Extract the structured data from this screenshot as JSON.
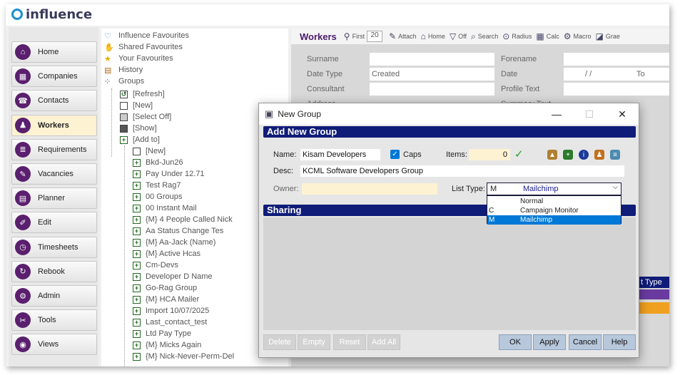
{
  "app": {
    "title": "influence"
  },
  "nav": {
    "items": [
      {
        "label": "Home",
        "icon": "home-icon",
        "glyph": "⌂"
      },
      {
        "label": "Companies",
        "icon": "companies-icon",
        "glyph": "▦"
      },
      {
        "label": "Contacts",
        "icon": "contacts-icon",
        "glyph": "☎"
      },
      {
        "label": "Workers",
        "icon": "workers-icon",
        "glyph": "♟"
      },
      {
        "label": "Requirements",
        "icon": "requirements-icon",
        "glyph": "≣"
      },
      {
        "label": "Vacancies",
        "icon": "vacancies-icon",
        "glyph": "✎"
      },
      {
        "label": "Planner",
        "icon": "planner-icon",
        "glyph": "▤"
      },
      {
        "label": "Edit",
        "icon": "edit-icon",
        "glyph": "✐"
      },
      {
        "label": "Timesheets",
        "icon": "timesheets-icon",
        "glyph": "◷"
      },
      {
        "label": "Rebook",
        "icon": "rebook-icon",
        "glyph": "↻"
      },
      {
        "label": "Admin",
        "icon": "admin-icon",
        "glyph": "⚙"
      },
      {
        "label": "Tools",
        "icon": "tools-icon",
        "glyph": "✂"
      },
      {
        "label": "Views",
        "icon": "views-icon",
        "glyph": "◉"
      }
    ],
    "active": "Workers"
  },
  "tree": {
    "top": [
      "Influence Favourites",
      "Shared Favourites",
      "Your Favourites",
      "History",
      "Groups"
    ],
    "groups": [
      "[Refresh]",
      "[New]",
      "[Select Off]",
      "[Show]",
      "[Add to]"
    ],
    "add_to": [
      "[New]",
      "Bkd-Jun26",
      "Pay Under 12.71",
      "Test Rag7",
      "00 Groups",
      "00 Instant Mail",
      "{M} 4 People Called Nick",
      "Aa Status Change Tes",
      "{M} Aa-Jack (Name)",
      "{M} Active Hcas",
      "Cm-Devs",
      "Developer D Name",
      "Go-Rag Group",
      "{M} HCA Mailer",
      "Import 10/07/2025",
      "Last_contact_test",
      "Ltd Pay Type",
      "{M} Micks Again",
      "{M} Nick-Never-Perm-Del"
    ]
  },
  "toolbar": {
    "title": "Workers",
    "first_label": "First",
    "first_value": "20",
    "attach": "Attach",
    "home": "Home",
    "off": "Off",
    "search": "Search",
    "radius": "Radius",
    "calc": "Calc",
    "macro": "Macro",
    "grae": "Grae"
  },
  "form": {
    "surname": "Surname",
    "forename": "Forename",
    "date_type": "Date Type",
    "date_type_value": "Created",
    "date": "Date",
    "date_value": "/ /",
    "to": "To",
    "consultant": "Consultant",
    "profile_text": "Profile Text",
    "address": "Address",
    "summary_text": "Summary Text"
  },
  "background_fragments": {
    "list_type_label": "t Type"
  },
  "dialog": {
    "title": "New Group",
    "header": "Add New Group",
    "name_label": "Name:",
    "name_value": "Kisam Developers",
    "caps_label": "Caps",
    "items_label": "Items:",
    "items_value": "0",
    "desc_label": "Desc:",
    "desc_value": "KCML Software Developers Group",
    "owner_label": "Owner:",
    "owner_value": "",
    "list_type_label": "List Type:",
    "list_type_code": "M",
    "list_type_value": "Mailchimp",
    "options": [
      {
        "code": "",
        "label": "Normal"
      },
      {
        "code": "C",
        "label": "Campaign Monitor"
      },
      {
        "code": "M",
        "label": "Mailchimp"
      }
    ],
    "sharing": "Sharing",
    "buttons": {
      "delete": "Delete",
      "empty": "Empty",
      "reset": "Reset",
      "add_all": "Add All",
      "ok": "OK",
      "apply": "Apply",
      "cancel": "Cancel",
      "help": "Help"
    }
  },
  "colors": {
    "header_bg": "#0f1c78",
    "brand": "#5a1f6e",
    "selection": "#0078d7"
  }
}
